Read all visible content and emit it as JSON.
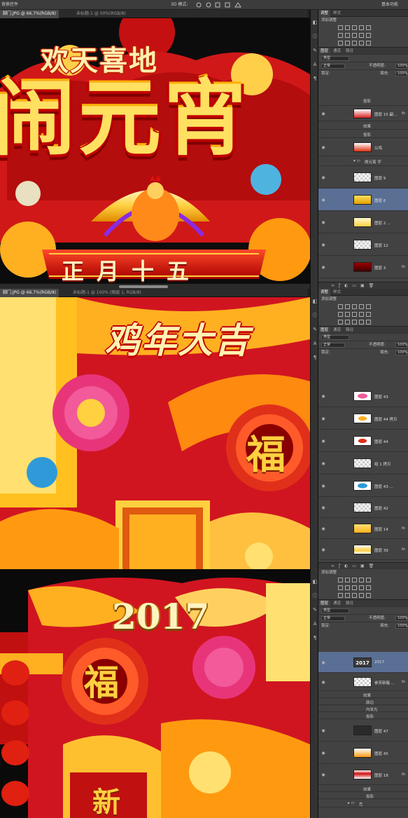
{
  "s1": {
    "menu": {
      "left": "背换控件",
      "mode": "3D 模式:",
      "workspace": "基本功能"
    },
    "tabs": [
      "脚门.JPG @ 66.7%(RGB/8)",
      "未标题-1 @ 50%(RGB/8)"
    ],
    "art": {
      "title_small": "欢天喜地",
      "title_big": "闹元宵",
      "banner": "正月十五"
    },
    "panel": {
      "tabs": [
        "调整",
        "样式"
      ],
      "add": "添加调整",
      "ltabs": [
        "图层",
        "通道",
        "路径"
      ],
      "kind": "类型",
      "blend": "正常",
      "opacity_label": "不透明度:",
      "opacity": "100%",
      "lock": "锁定:",
      "fill_label": "填充:",
      "fill": "100%",
      "layers": [
        {
          "name": "投影",
          "sub": true
        },
        {
          "name": "图层 15 副...",
          "fx": "fx"
        },
        {
          "name": "效果",
          "sub": true
        },
        {
          "name": "投影",
          "sub": true
        },
        {
          "name": "公鸡"
        },
        {
          "name": "闹元宵 字",
          "group": true
        },
        {
          "name": "图层 9"
        },
        {
          "name": "图层 6",
          "selected": true
        },
        {
          "name": "图层 2 ..."
        },
        {
          "name": "图层 12"
        },
        {
          "name": "图层 3",
          "fx": "fx"
        }
      ]
    }
  },
  "s2": {
    "tabs": [
      "脚门.JPG @ 66.7%(RGB/8)",
      "未标题-1 @ 100% (图层 1, RGB/8)"
    ],
    "art": {
      "title": "鸡年大吉",
      "fu": "福"
    },
    "panel": {
      "tabs": [
        "调整",
        "样式"
      ],
      "add": "添加调整",
      "ltabs": [
        "图层",
        "通道",
        "路径"
      ],
      "kind": "类型",
      "blend": "正常",
      "opacity_label": "不透明度:",
      "opacity": "100%",
      "lock": "锁定:",
      "fill_label": "填充:",
      "fill": "100%",
      "layers": [
        {
          "name": "图层 43"
        },
        {
          "name": "图层 44 拷贝"
        },
        {
          "name": "图层 44"
        },
        {
          "name": "组 1 拷贝"
        },
        {
          "name": "图层 43 ..."
        },
        {
          "name": "图层 42"
        },
        {
          "name": "图层 14",
          "fx": "fx"
        },
        {
          "name": "图层 39",
          "fx": "fx"
        }
      ]
    }
  },
  "s3": {
    "art": {
      "year": "2017",
      "fu": "福",
      "xin": "新"
    },
    "panel": {
      "add": "添加调整",
      "ltabs": [
        "图层",
        "通道",
        "路径"
      ],
      "kind": "类型",
      "blend": "正常",
      "opacity_label": "不透明度:",
      "opacity": "100%",
      "lock": "锁定:",
      "fill_label": "填充:",
      "fill": "100%",
      "layers": [
        {
          "name": "2017",
          "selected": true
        },
        {
          "name": "参芳新箱 ...",
          "fx": "fx"
        },
        {
          "name": "效果",
          "sub": true
        },
        {
          "name": "颜边",
          "sub": true
        },
        {
          "name": "内发光",
          "sub": true
        },
        {
          "name": "投影",
          "sub": true
        },
        {
          "name": "图层 47"
        },
        {
          "name": "图层 45"
        },
        {
          "name": "图层 18",
          "fx": "fx"
        },
        {
          "name": "效果",
          "sub": true
        },
        {
          "name": "投影",
          "sub": true
        },
        {
          "name": "左",
          "group": true
        }
      ]
    }
  }
}
